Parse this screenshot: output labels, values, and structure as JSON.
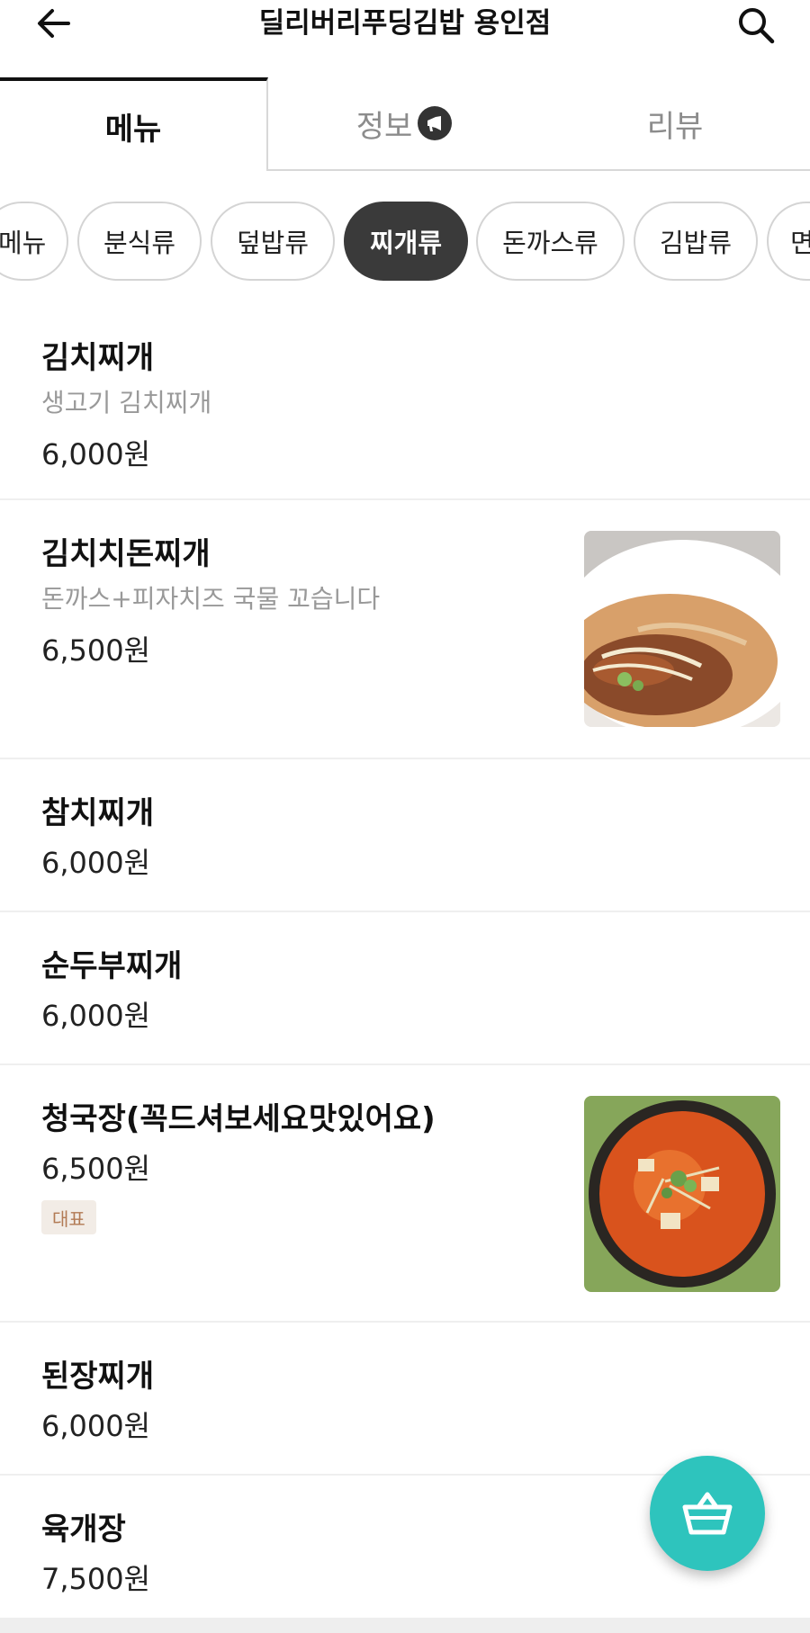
{
  "header": {
    "title": "딜리버리푸딩김밥 용인점",
    "back_icon": "arrow-left-icon",
    "search_icon": "search-icon"
  },
  "tabs": [
    {
      "label": "메뉴",
      "active": true
    },
    {
      "label": "정보",
      "active": false,
      "icon": "megaphone-icon"
    },
    {
      "label": "리뷰",
      "active": false
    }
  ],
  "categories": [
    {
      "label": "메뉴",
      "active": false
    },
    {
      "label": "분식류",
      "active": false
    },
    {
      "label": "덮밥류",
      "active": false
    },
    {
      "label": "찌개류",
      "active": true
    },
    {
      "label": "돈까스류",
      "active": false
    },
    {
      "label": "김밥류",
      "active": false
    },
    {
      "label": "면",
      "active": false
    }
  ],
  "items": [
    {
      "name": "김치찌개",
      "desc": "생고기 김치찌개",
      "price": "6,000원"
    },
    {
      "name": "김치치돈찌개",
      "desc": "돈까스+피자치즈 국물 꼬습니다",
      "price": "6,500원",
      "image": "katsu-stew-photo"
    },
    {
      "name": "참치찌개",
      "price": "6,000원"
    },
    {
      "name": "순두부찌개",
      "price": "6,000원"
    },
    {
      "name": "청국장(꼭드셔보세요맛있어요)",
      "price": "6,500원",
      "badge": "대표",
      "image": "soybean-stew-photo"
    },
    {
      "name": "된장찌개",
      "price": "6,000원"
    },
    {
      "name": "육개장",
      "price": "7,500원"
    }
  ],
  "colors": {
    "accent": "#2ec4bd",
    "chip_active": "#3a3a3a",
    "badge_bg": "#f2ece6",
    "badge_text": "#b27a54"
  },
  "fab": {
    "icon": "shopping-basket-icon"
  }
}
